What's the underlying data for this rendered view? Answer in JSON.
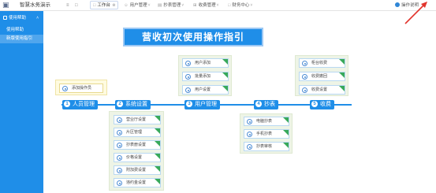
{
  "topbar": {
    "app_title": "智慧水务演示",
    "tabs": [
      {
        "label": "工作台",
        "icon": "home-icon"
      },
      {
        "label": "用户管理",
        "icon": "user-icon"
      },
      {
        "label": "抄表管理",
        "icon": "meter-icon"
      },
      {
        "label": "收费管理",
        "icon": "grid-icon"
      },
      {
        "label": "财务中心",
        "icon": "doc-icon"
      }
    ],
    "help": "操作说明"
  },
  "sidebar": {
    "group": "使用帮助",
    "items": [
      "使用帮助",
      "新版使用指引"
    ]
  },
  "main": {
    "title": "营收初次使用操作指引",
    "steps": [
      {
        "num": "1",
        "label": "人员管理"
      },
      {
        "num": "2",
        "label": "系统设置"
      },
      {
        "num": "3",
        "label": "用户管理"
      },
      {
        "num": "4",
        "label": "抄表"
      },
      {
        "num": "5",
        "label": "收费"
      }
    ],
    "staff_card": "添加操作员",
    "system_cards": [
      "营业厅设置",
      "片区管理",
      "抄表册设置",
      "价格设置",
      "附加费设置",
      "违约金设置"
    ],
    "user_cards": [
      "用户添加",
      "批量添加",
      "用户设置"
    ],
    "meter_cards": [
      "电脑抄表",
      "手机抄表",
      "抄表审核"
    ],
    "fee_cards": [
      "柜台收费",
      "收费撤回",
      "收费设置"
    ]
  },
  "colors": {
    "accent": "#1f8ee8",
    "group_bg": "#eef4e6",
    "corner_mark": "#38a95a"
  }
}
